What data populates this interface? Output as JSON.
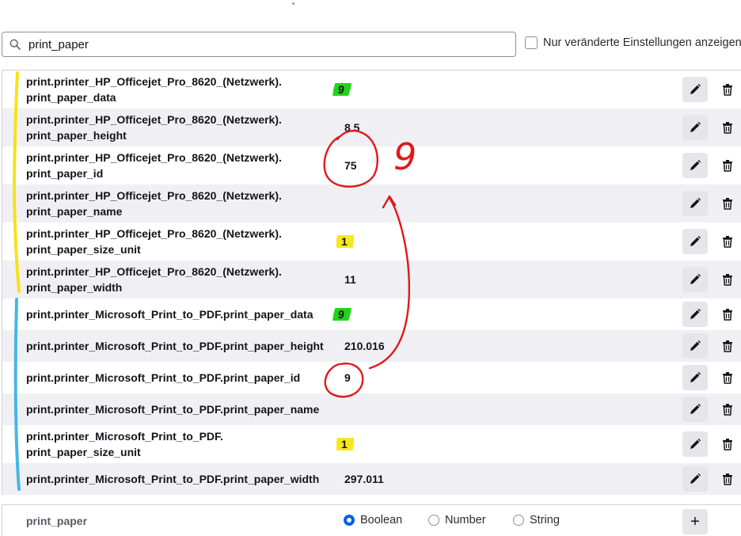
{
  "search": {
    "value": "print_paper",
    "placeholder": ""
  },
  "filter": {
    "label": "Nur veränderte Einstellungen anzeigen",
    "checked": false
  },
  "rows": [
    {
      "name1": "print.printer_HP_Officejet_Pro_8620_(Netzwerk).",
      "name2": "print_paper_data",
      "value": "9"
    },
    {
      "name1": "print.printer_HP_Officejet_Pro_8620_(Netzwerk).",
      "name2": "print_paper_height",
      "value": "8.5"
    },
    {
      "name1": "print.printer_HP_Officejet_Pro_8620_(Netzwerk).",
      "name2": "print_paper_id",
      "value": "75"
    },
    {
      "name1": "print.printer_HP_Officejet_Pro_8620_(Netzwerk).",
      "name2": "print_paper_name",
      "value": ""
    },
    {
      "name1": "print.printer_HP_Officejet_Pro_8620_(Netzwerk).",
      "name2": "print_paper_size_unit",
      "value": "1"
    },
    {
      "name1": "print.printer_HP_Officejet_Pro_8620_(Netzwerk).",
      "name2": "print_paper_width",
      "value": "11"
    },
    {
      "name1": "print.printer_Microsoft_Print_to_PDF.print_paper_data",
      "value": "9"
    },
    {
      "name1": "print.printer_Microsoft_Print_to_PDF.print_paper_height",
      "value": "210.016"
    },
    {
      "name1": "print.printer_Microsoft_Print_to_PDF.print_paper_id",
      "value": "9"
    },
    {
      "name1": "print.printer_Microsoft_Print_to_PDF.print_paper_name",
      "value": ""
    },
    {
      "name1": "print.printer_Microsoft_Print_to_PDF.",
      "name2": "print_paper_size_unit",
      "value": "1"
    },
    {
      "name1": "print.printer_Microsoft_Print_to_PDF.print_paper_width",
      "value": "297.011"
    }
  ],
  "add_row": {
    "name": "print_paper",
    "types": [
      "Boolean",
      "Number",
      "String"
    ],
    "selected": "Boolean",
    "add_symbol": "+"
  },
  "annotations": {
    "handwritten_digit": "9"
  },
  "colors": {
    "highlight_green": "#21d31b",
    "highlight_yellow": "#f7e81b",
    "bracket_yellow": "#f6e21a",
    "bracket_blue": "#45b6e6",
    "pen_red": "#e0191c",
    "radio_accent": "#0061e0"
  },
  "icons": [
    "search-icon",
    "pencil-icon",
    "trash-icon",
    "plus-icon"
  ]
}
